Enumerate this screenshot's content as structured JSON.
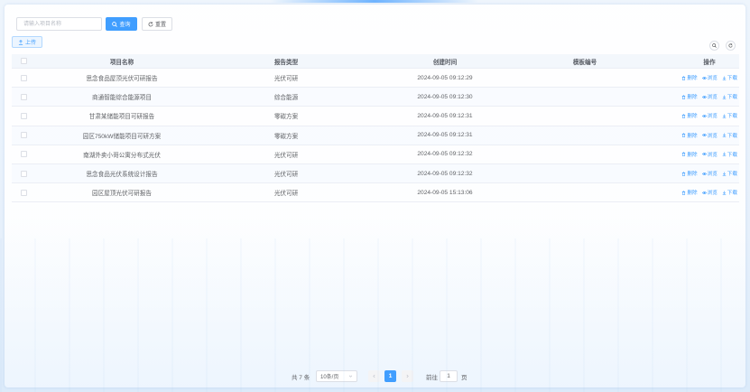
{
  "search": {
    "placeholder": "请输入项目名称",
    "value": "",
    "query_label": "查询",
    "reset_label": "重置"
  },
  "toolbar": {
    "upload_label": "上传"
  },
  "table": {
    "headers": {
      "name": "项目名称",
      "type": "报告类型",
      "created": "创建时间",
      "template": "模板编号",
      "actions": "操作"
    },
    "action_labels": {
      "delete": "删除",
      "view": "浏览",
      "download": "下载"
    },
    "rows": [
      {
        "name": "思念食品屋顶光伏可研报告",
        "type": "光伏可研",
        "created": "2024-09-05 09:12:29",
        "template": ""
      },
      {
        "name": "商通智能综合能源项目",
        "type": "综合能源",
        "created": "2024-09-05 09:12:30",
        "template": ""
      },
      {
        "name": "甘肃某储能项目可研报告",
        "type": "零碳方案",
        "created": "2024-09-05 09:12:31",
        "template": ""
      },
      {
        "name": "园区750kW储能项目可研方案",
        "type": "零碳方案",
        "created": "2024-09-05 09:12:31",
        "template": ""
      },
      {
        "name": "南湖外卖小哥公寓分布式光伏",
        "type": "光伏可研",
        "created": "2024-09-05 09:12:32",
        "template": ""
      },
      {
        "name": "思念食品光伏系统设计报告",
        "type": "光伏可研",
        "created": "2024-09-05 09:12:32",
        "template": ""
      },
      {
        "name": "园区屋顶光伏可研报告",
        "type": "光伏可研",
        "created": "2024-09-05 15:13:06",
        "template": ""
      }
    ]
  },
  "pagination": {
    "total": "共 7 条",
    "page_size": "10条/页",
    "current_page": "1",
    "goto_label": "前往",
    "goto_value": "1",
    "page_suffix": "页"
  },
  "colors": {
    "primary": "#409eff",
    "text": "#606266",
    "border": "#dcdfe6"
  }
}
